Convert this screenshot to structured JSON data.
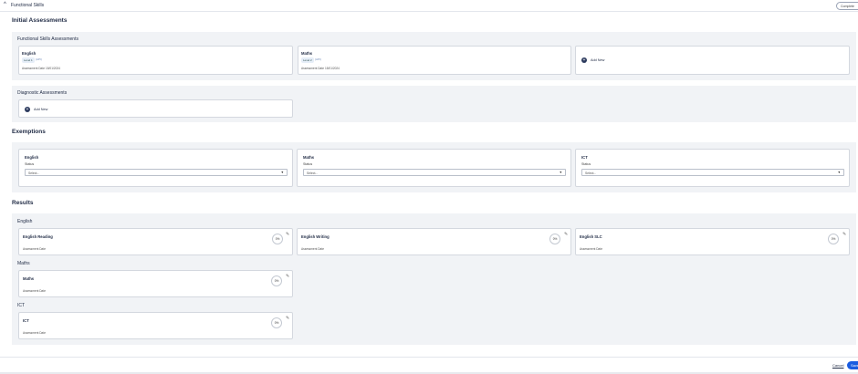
{
  "header": {
    "collapse_icon": "chevron-up-icon",
    "title": "Functional Skills",
    "status_button": "Complete"
  },
  "initial_assessments": {
    "heading": "Initial Assessments",
    "functional_skills": {
      "subheading": "Functional Skills Assessments",
      "cards": [
        {
          "title": "English",
          "level": "Level 1",
          "tag": "(API)",
          "date_label": "Assessment Date",
          "date": "15/01/2024"
        },
        {
          "title": "Maths",
          "level": "Level 2",
          "tag": "(API)",
          "date_label": "Assessment Date",
          "date": "15/01/2024"
        }
      ],
      "add_new": "Add New"
    },
    "diagnostic": {
      "subheading": "Diagnostic Assessments",
      "add_new": "Add New"
    }
  },
  "exemptions": {
    "heading": "Exemptions",
    "items": [
      {
        "title": "English",
        "status_label": "Status",
        "placeholder": "Select..."
      },
      {
        "title": "Maths",
        "status_label": "Status",
        "placeholder": "Select..."
      },
      {
        "title": "ICT",
        "status_label": "Status",
        "placeholder": "Select..."
      }
    ]
  },
  "results": {
    "heading": "Results",
    "groups": [
      {
        "name": "English",
        "cards": [
          {
            "title": "English Reading",
            "date_label": "Assessment Date",
            "score": "0%"
          },
          {
            "title": "English Writing",
            "date_label": "Assessment Date",
            "score": "0%"
          },
          {
            "title": "English SLC",
            "date_label": "Assessment Date",
            "score": "0%"
          }
        ]
      },
      {
        "name": "Maths",
        "cards": [
          {
            "title": "Maths",
            "date_label": "Assessment Date",
            "score": "0%"
          }
        ]
      },
      {
        "name": "ICT",
        "cards": [
          {
            "title": "ICT",
            "date_label": "Assessment Date",
            "score": "0%"
          }
        ]
      }
    ]
  },
  "footer": {
    "cancel": "Cancel",
    "primary": "Save"
  }
}
